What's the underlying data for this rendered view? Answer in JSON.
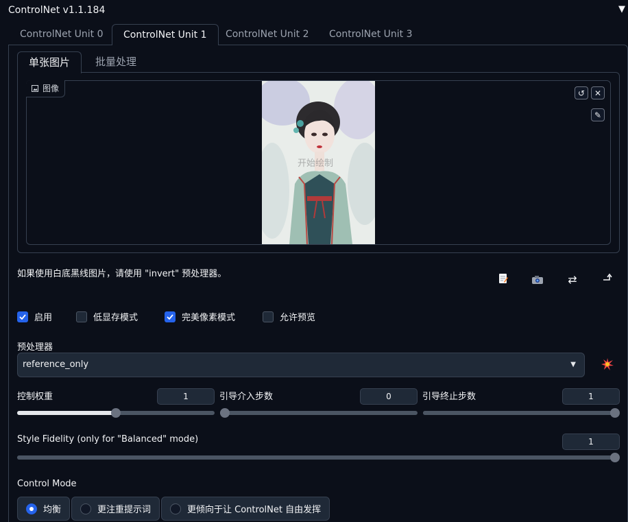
{
  "header": {
    "title": "ControlNet v1.1.184",
    "collapse_icon": "▼"
  },
  "unit_tabs": [
    "ControlNet Unit 0",
    "ControlNet Unit 1",
    "ControlNet Unit 2",
    "ControlNet Unit 3"
  ],
  "active_unit_tab": 1,
  "sub_tabs": [
    "单张图片",
    "批量处理"
  ],
  "active_sub_tab": 0,
  "image_input": {
    "label": "图像",
    "watermark": "开始绘制"
  },
  "hint": "如果使用白底黑线图片，请使用 \"invert\" 预处理器。",
  "action_icons": [
    "new-canvas-icon",
    "camera-icon",
    "swap-icon",
    "send-dimensions-icon"
  ],
  "checkboxes": [
    {
      "label": "启用",
      "checked": true
    },
    {
      "label": "低显存模式",
      "checked": false
    },
    {
      "label": "完美像素模式",
      "checked": true
    },
    {
      "label": "允许预览",
      "checked": false
    }
  ],
  "preprocessor": {
    "label": "预处理器",
    "value": "reference_only"
  },
  "sliders": {
    "weight": {
      "label": "控制权重",
      "value": "1",
      "fraction": 0.5
    },
    "start": {
      "label": "引导介入步数",
      "value": "0",
      "fraction": 0
    },
    "end": {
      "label": "引导终止步数",
      "value": "1",
      "fraction": 1
    },
    "fidelity": {
      "label": "Style Fidelity (only for \"Balanced\" mode)",
      "value": "1",
      "fraction": 1
    }
  },
  "control_mode": {
    "label": "Control Mode",
    "options": [
      "均衡",
      "更注重提示词",
      "更倾向于让 ControlNet 自由发挥"
    ],
    "selected": 0
  },
  "colors": {
    "background": "#0b0f19",
    "accent": "#2563eb",
    "border": "#374151"
  }
}
